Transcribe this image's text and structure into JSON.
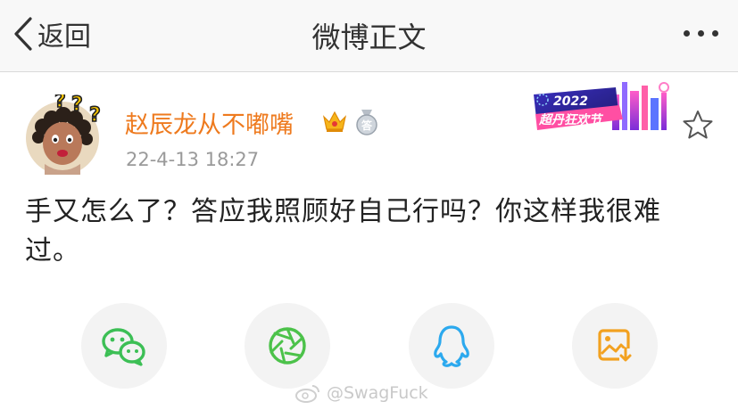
{
  "nav": {
    "back_label": "返回",
    "title": "微博正文",
    "more_icon": "more-dots-icon"
  },
  "post": {
    "user_name": "赵辰龙从不嘟嘴",
    "timestamp": "22-4-13 18:27",
    "text": "手又怎么了？答应我照顾好自己行吗？你这样我很难过。",
    "badge_text_year": "2022",
    "badge_text_title": "超丹狂欢节",
    "medal_char": "答",
    "icons": [
      "avatar",
      "crown-icon",
      "medal-icon",
      "star-icon"
    ]
  },
  "share": [
    {
      "name": "wechat",
      "color": "#3cbf55"
    },
    {
      "name": "moments",
      "color": "#4cc24a"
    },
    {
      "name": "qq",
      "color": "#2ca9ee"
    },
    {
      "name": "save-image",
      "color": "#f2a120"
    }
  ],
  "watermark": {
    "handle": "@SwagFuck"
  }
}
